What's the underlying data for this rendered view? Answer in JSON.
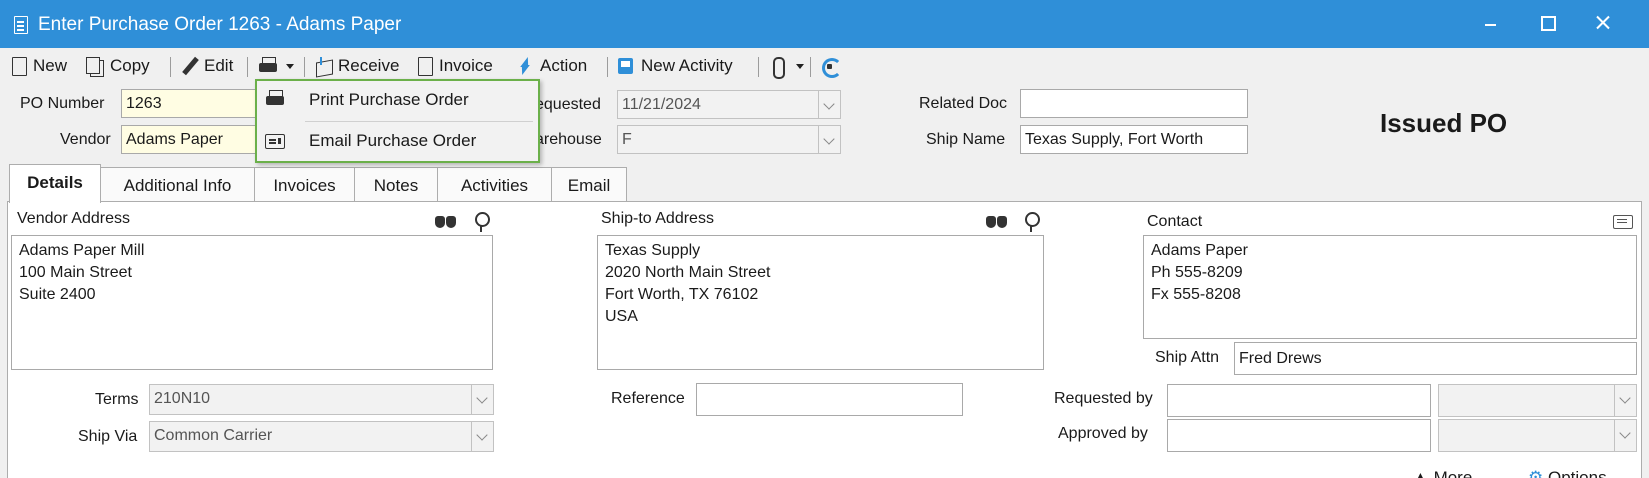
{
  "window": {
    "title": "Enter Purchase Order 1263 - Adams Paper"
  },
  "toolbar": {
    "new_label": "New",
    "copy_label": "Copy",
    "edit_label": "Edit",
    "receive_label": "Receive",
    "invoice_label": "Invoice",
    "action_label": "Action",
    "new_activity_label": "New Activity"
  },
  "print_menu": {
    "items": [
      {
        "label": "Print Purchase Order",
        "icon": "printer-icon"
      },
      {
        "label": "Email Purchase Order",
        "icon": "email-icon"
      }
    ]
  },
  "header": {
    "po_number_label": "PO Number",
    "po_number_value": "1263",
    "vendor_label": "Vendor",
    "vendor_value": "Adams Paper",
    "requested_label": "equested",
    "requested_value": "11/21/2024",
    "warehouse_label": "arehouse",
    "warehouse_value": "F",
    "related_doc_label": "Related Doc",
    "related_doc_value": "",
    "ship_name_label": "Ship Name",
    "ship_name_value": "Texas Supply, Fort Worth",
    "status": "Issued PO"
  },
  "tabs": [
    {
      "label": "Details",
      "active": true
    },
    {
      "label": "Additional Info"
    },
    {
      "label": "Invoices"
    },
    {
      "label": "Notes"
    },
    {
      "label": "Activities"
    },
    {
      "label": "Email"
    }
  ],
  "details": {
    "vendor_address_label": "Vendor Address",
    "vendor_address_lines": [
      "Adams Paper Mill",
      "100 Main Street",
      "Suite 2400"
    ],
    "ship_to_label": "Ship-to Address",
    "ship_to_lines": [
      "Texas Supply",
      "2020 North Main Street",
      "Fort Worth, TX 76102",
      "USA"
    ],
    "contact_label": "Contact",
    "contact_lines": [
      "Adams Paper",
      "Ph 555-8209",
      "Fx 555-8208"
    ],
    "ship_attn_label": "Ship Attn",
    "ship_attn_value": "Fred Drews",
    "terms_label": "Terms",
    "terms_value": "210N10",
    "ship_via_label": "Ship Via",
    "ship_via_value": "Common Carrier",
    "reference_label": "Reference",
    "reference_value": "",
    "requested_by_label": "Requested by",
    "requested_by_value": "",
    "approved_by_label": "Approved by",
    "approved_by_value": ""
  },
  "footer": {
    "more_label": "More",
    "options_label": "Options"
  }
}
